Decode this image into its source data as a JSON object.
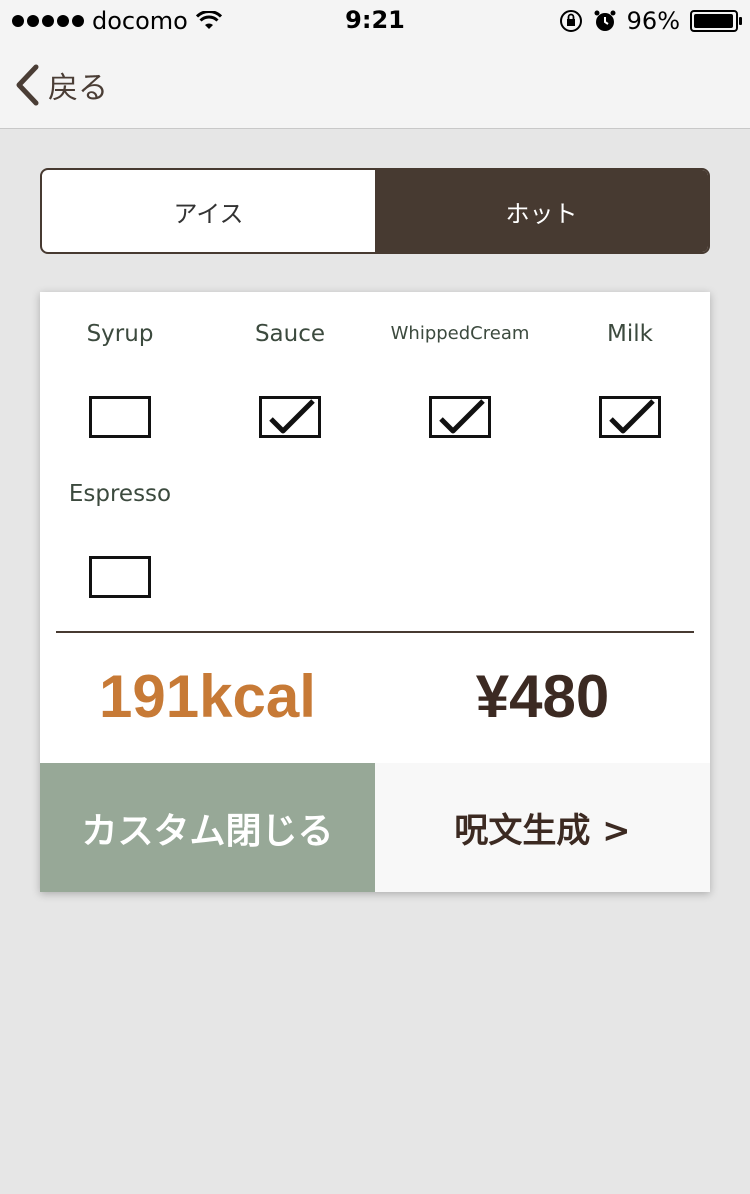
{
  "status_bar": {
    "carrier": "docomo",
    "time": "9:21",
    "battery": "96%",
    "icons": [
      "signal-dots-icon",
      "wifi-icon",
      "rotation-lock-icon",
      "alarm-icon",
      "battery-icon"
    ]
  },
  "nav": {
    "back_label": "戻る"
  },
  "temperature": {
    "options": [
      "アイス",
      "ホット"
    ],
    "selected": "ホット"
  },
  "customizations": [
    {
      "label": "Syrup",
      "checked": false
    },
    {
      "label": "Sauce",
      "checked": true
    },
    {
      "label": "WhippedCream",
      "checked": true
    },
    {
      "label": "Milk",
      "checked": true
    },
    {
      "label": "Espresso",
      "checked": false
    }
  ],
  "totals": {
    "calories": "191kcal",
    "price": "¥480"
  },
  "actions": {
    "close_label": "カスタム閉じる",
    "generate_label": "呪文生成 >"
  },
  "colors": {
    "accent_dark_brown": "#473a31",
    "calorie_orange": "#c77a36",
    "close_button_green": "#97a897",
    "background": "#e6e6e6"
  }
}
